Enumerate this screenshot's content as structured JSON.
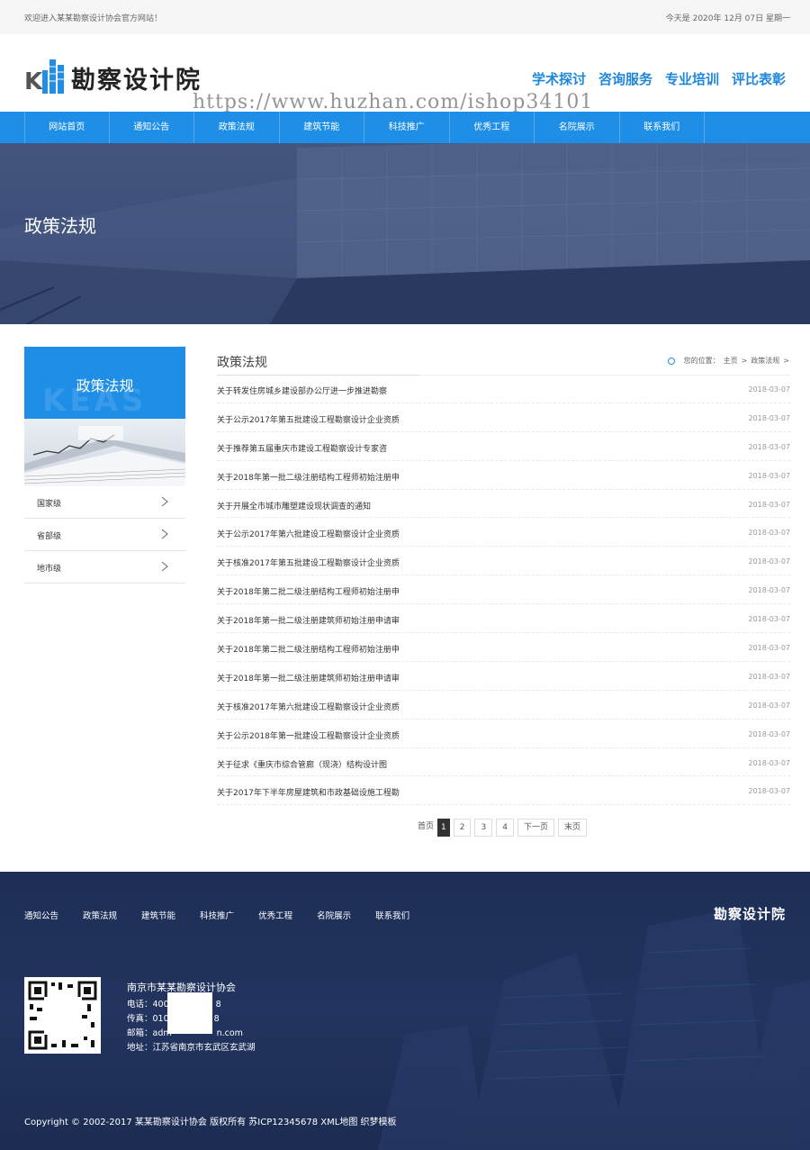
{
  "topbar": {
    "welcome": "欢迎进入某某勘察设计协会官方网站！",
    "date": "今天是 2020年 12月 07日 星期一"
  },
  "header": {
    "logo_letter": "K",
    "logo_name": "勘察设计院",
    "watermark": "https://www.huzhan.com/ishop34101",
    "links": [
      "学术探讨",
      "咨询服务",
      "专业培训",
      "评比表彰"
    ]
  },
  "nav": {
    "items": [
      "网站首页",
      "通知公告",
      "政策法规",
      "建筑节能",
      "科技推广",
      "优秀工程",
      "名院展示",
      "联系我们"
    ]
  },
  "banner": {
    "title": "政策法规"
  },
  "sidebar": {
    "title": "政策法规",
    "ghost_text": "KEAS",
    "items": [
      {
        "label": "国家级"
      },
      {
        "label": "省部级"
      },
      {
        "label": "地市级"
      }
    ]
  },
  "main": {
    "title": "政策法规",
    "breadcrumb": {
      "prefix": "您的位置：",
      "home": "主页",
      "sep1": ">",
      "current": "政策法规",
      "sep2": ">"
    },
    "news": [
      {
        "title": "关于转发住房城乡建设部办公厅进一步推进勘察",
        "date": "2018-03-07"
      },
      {
        "title": "关于公示2017年第五批建设工程勘察设计企业资质",
        "date": "2018-03-07"
      },
      {
        "title": "关于推荐第五届重庆市建设工程勘察设计专家咨",
        "date": "2018-03-07"
      },
      {
        "title": "关于2018年第一批二级注册结构工程师初始注册申",
        "date": "2018-03-07"
      },
      {
        "title": "关于开展全市城市雕塑建设现状调查的通知",
        "date": "2018-03-07"
      },
      {
        "title": "关于公示2017年第六批建设工程勘察设计企业资质",
        "date": "2018-03-07"
      },
      {
        "title": "关于核准2017年第五批建设工程勘察设计企业资质",
        "date": "2018-03-07"
      },
      {
        "title": "关于2018年第二批二级注册结构工程师初始注册申",
        "date": "2018-03-07"
      },
      {
        "title": "关于2018年第一批二级注册建筑师初始注册申请审",
        "date": "2018-03-07"
      },
      {
        "title": "关于2018年第二批二级注册结构工程师初始注册申",
        "date": "2018-03-07"
      },
      {
        "title": "关于2018年第一批二级注册建筑师初始注册申请审",
        "date": "2018-03-07"
      },
      {
        "title": "关于核准2017年第六批建设工程勘察设计企业资质",
        "date": "2018-03-07"
      },
      {
        "title": "关于公示2018年第一批建设工程勘察设计企业资质",
        "date": "2018-03-07"
      },
      {
        "title": "关于征求《重庆市综合管廊（现浇）结构设计图",
        "date": "2018-03-07"
      },
      {
        "title": "关于2017年下半年房屋建筑和市政基础设施工程勘",
        "date": "2018-03-07"
      }
    ]
  },
  "pager": {
    "first": "首页",
    "pages": [
      "1",
      "2",
      "3",
      "4"
    ],
    "current": "1",
    "next": "下一页",
    "last": "末页"
  },
  "footer": {
    "nav": [
      "通知公告",
      "政策法规",
      "建筑节能",
      "科技推广",
      "优秀工程",
      "名院展示",
      "联系我们"
    ],
    "logo": "勘察设计院",
    "org": "南京市某某勘察设计协会",
    "phone": "电话：400",
    "phone_tail": "8",
    "fax": "传真：010",
    "fax_tail": "8",
    "email": "邮箱：adm",
    "email_tail": "n.com",
    "address": "地址：江苏省南京市玄武区玄武湖",
    "copyright": "Copyright © 2002-2017 某某勘察设计协会 版权所有  苏ICP12345678  XML地图  织梦模板"
  },
  "colors": {
    "primary": "#1e8ee6",
    "header_link": "#1f86d9",
    "footer_bg": "#1d2e56",
    "banner_bg": "#3d4f7a"
  }
}
